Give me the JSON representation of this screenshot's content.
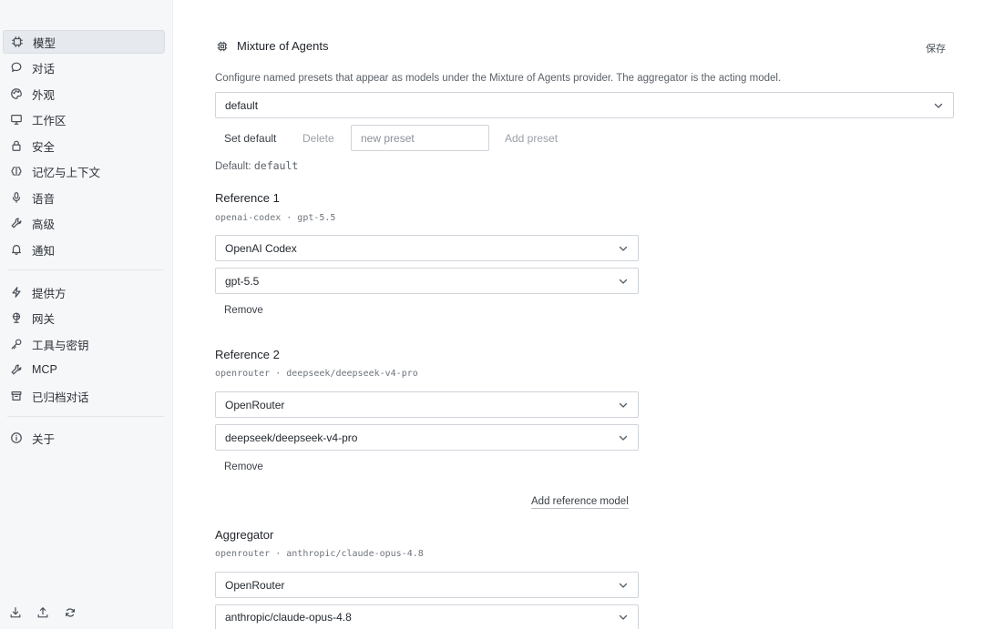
{
  "sidebar": {
    "items": [
      {
        "label": "模型",
        "icon": "chip-icon",
        "active": true
      },
      {
        "label": "对话",
        "icon": "chat-bubble-icon"
      },
      {
        "label": "外观",
        "icon": "palette-icon"
      },
      {
        "label": "工作区",
        "icon": "monitor-icon"
      },
      {
        "label": "安全",
        "icon": "lock-icon"
      },
      {
        "label": "记忆与上下文",
        "icon": "brain-icon"
      },
      {
        "label": "语音",
        "icon": "microphone-icon"
      },
      {
        "label": "高级",
        "icon": "wrench-icon"
      },
      {
        "label": "通知",
        "icon": "bell-icon"
      },
      {
        "label": "提供方",
        "icon": "lightning-icon"
      },
      {
        "label": "网关",
        "icon": "globe-icon"
      },
      {
        "label": "工具与密钥",
        "icon": "key-icon"
      },
      {
        "label": "MCP",
        "icon": "tool-icon"
      },
      {
        "label": "已归档对话",
        "icon": "archive-icon"
      },
      {
        "label": "关于",
        "icon": "info-icon"
      }
    ],
    "bottom_icons": [
      "download-icon",
      "upload-icon",
      "refresh-icon"
    ]
  },
  "main": {
    "title": "Mixture of Agents",
    "title_icon": "chip-icon",
    "save_label": "保存",
    "description": "Configure named presets that appear as models under the Mixture of Agents provider. The aggregator is the acting model.",
    "preset_select": "default",
    "set_default_label": "Set default",
    "delete_label": "Delete",
    "new_preset_placeholder": "new preset",
    "add_preset_label": "Add preset",
    "default_prefix": "Default:",
    "default_value": "default",
    "references": [
      {
        "title": "Reference 1",
        "subtitle": "openai-codex · gpt-5.5",
        "provider": "OpenAI Codex",
        "model": "gpt-5.5",
        "remove_label": "Remove"
      },
      {
        "title": "Reference 2",
        "subtitle": "openrouter · deepseek/deepseek-v4-pro",
        "provider": "OpenRouter",
        "model": "deepseek/deepseek-v4-pro",
        "remove_label": "Remove"
      }
    ],
    "add_reference_label": "Add reference model",
    "aggregator": {
      "title": "Aggregator",
      "subtitle": "openrouter · anthropic/claude-opus-4.8",
      "provider": "OpenRouter",
      "model": "anthropic/claude-opus-4.8"
    }
  },
  "colors": {
    "sidebar_bg": "#f6f7f9",
    "active_item_bg": "#e6e9ed",
    "border": "#cfd4da",
    "text": "#24292f",
    "muted_text": "#9aa0a8"
  }
}
